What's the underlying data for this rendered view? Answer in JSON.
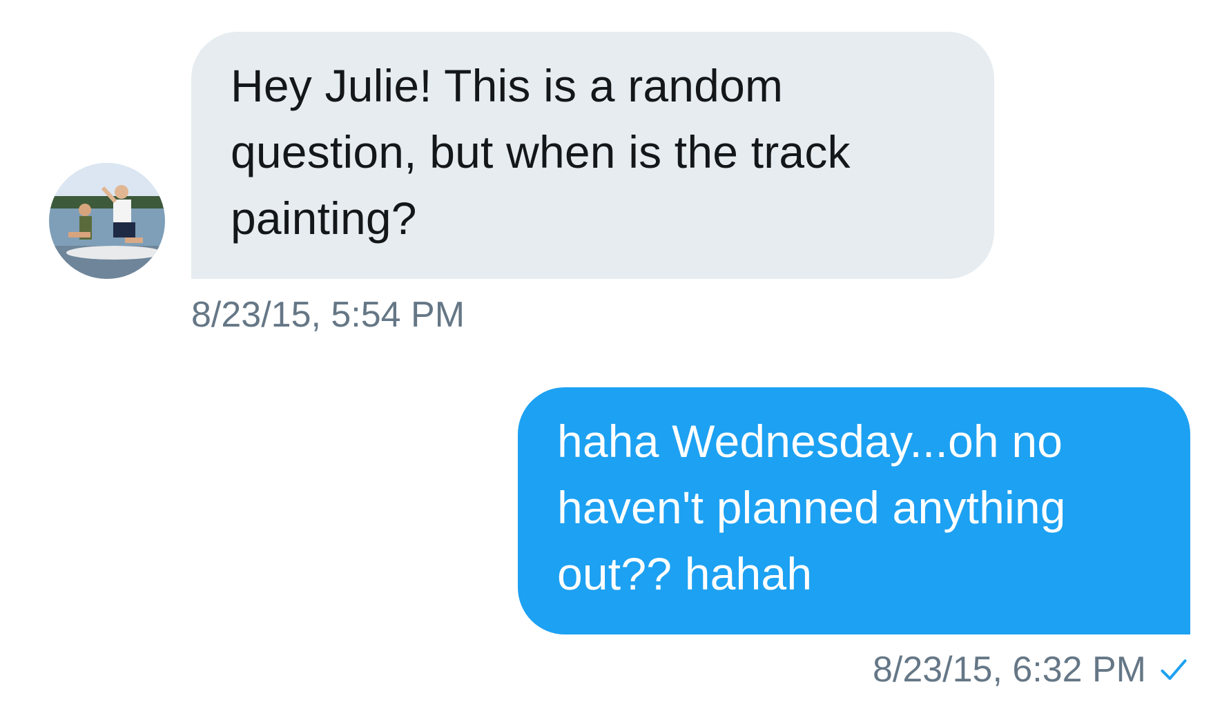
{
  "thread": {
    "incoming": {
      "avatar_icon": "profile-photo",
      "lines": [
        "Hey Julie! This is a random",
        "question, but when is the track",
        "painting?"
      ],
      "timestamp": "8/23/15, 5:54 PM",
      "bubble_color": "#e6ecf0"
    },
    "outgoing": {
      "lines": [
        "haha Wednesday...oh no",
        "haven't planned anything",
        "out?? hahah"
      ],
      "timestamp": "8/23/15, 6:32 PM",
      "status_icon": "check-icon",
      "bubble_color": "#1da1f2"
    }
  }
}
